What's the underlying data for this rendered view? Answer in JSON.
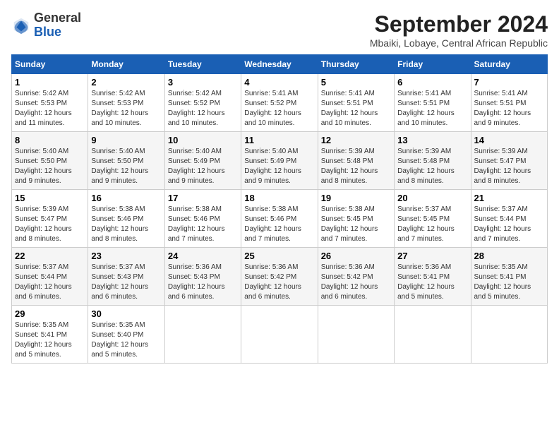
{
  "logo": {
    "general": "General",
    "blue": "Blue"
  },
  "header": {
    "month": "September 2024",
    "location": "Mbaiki, Lobaye, Central African Republic"
  },
  "weekdays": [
    "Sunday",
    "Monday",
    "Tuesday",
    "Wednesday",
    "Thursday",
    "Friday",
    "Saturday"
  ],
  "weeks": [
    [
      {
        "day": "1",
        "sunrise": "Sunrise: 5:42 AM",
        "sunset": "Sunset: 5:53 PM",
        "daylight": "Daylight: 12 hours and 11 minutes."
      },
      {
        "day": "2",
        "sunrise": "Sunrise: 5:42 AM",
        "sunset": "Sunset: 5:53 PM",
        "daylight": "Daylight: 12 hours and 10 minutes."
      },
      {
        "day": "3",
        "sunrise": "Sunrise: 5:42 AM",
        "sunset": "Sunset: 5:52 PM",
        "daylight": "Daylight: 12 hours and 10 minutes."
      },
      {
        "day": "4",
        "sunrise": "Sunrise: 5:41 AM",
        "sunset": "Sunset: 5:52 PM",
        "daylight": "Daylight: 12 hours and 10 minutes."
      },
      {
        "day": "5",
        "sunrise": "Sunrise: 5:41 AM",
        "sunset": "Sunset: 5:51 PM",
        "daylight": "Daylight: 12 hours and 10 minutes."
      },
      {
        "day": "6",
        "sunrise": "Sunrise: 5:41 AM",
        "sunset": "Sunset: 5:51 PM",
        "daylight": "Daylight: 12 hours and 10 minutes."
      },
      {
        "day": "7",
        "sunrise": "Sunrise: 5:41 AM",
        "sunset": "Sunset: 5:51 PM",
        "daylight": "Daylight: 12 hours and 9 minutes."
      }
    ],
    [
      {
        "day": "8",
        "sunrise": "Sunrise: 5:40 AM",
        "sunset": "Sunset: 5:50 PM",
        "daylight": "Daylight: 12 hours and 9 minutes."
      },
      {
        "day": "9",
        "sunrise": "Sunrise: 5:40 AM",
        "sunset": "Sunset: 5:50 PM",
        "daylight": "Daylight: 12 hours and 9 minutes."
      },
      {
        "day": "10",
        "sunrise": "Sunrise: 5:40 AM",
        "sunset": "Sunset: 5:49 PM",
        "daylight": "Daylight: 12 hours and 9 minutes."
      },
      {
        "day": "11",
        "sunrise": "Sunrise: 5:40 AM",
        "sunset": "Sunset: 5:49 PM",
        "daylight": "Daylight: 12 hours and 9 minutes."
      },
      {
        "day": "12",
        "sunrise": "Sunrise: 5:39 AM",
        "sunset": "Sunset: 5:48 PM",
        "daylight": "Daylight: 12 hours and 8 minutes."
      },
      {
        "day": "13",
        "sunrise": "Sunrise: 5:39 AM",
        "sunset": "Sunset: 5:48 PM",
        "daylight": "Daylight: 12 hours and 8 minutes."
      },
      {
        "day": "14",
        "sunrise": "Sunrise: 5:39 AM",
        "sunset": "Sunset: 5:47 PM",
        "daylight": "Daylight: 12 hours and 8 minutes."
      }
    ],
    [
      {
        "day": "15",
        "sunrise": "Sunrise: 5:39 AM",
        "sunset": "Sunset: 5:47 PM",
        "daylight": "Daylight: 12 hours and 8 minutes."
      },
      {
        "day": "16",
        "sunrise": "Sunrise: 5:38 AM",
        "sunset": "Sunset: 5:46 PM",
        "daylight": "Daylight: 12 hours and 8 minutes."
      },
      {
        "day": "17",
        "sunrise": "Sunrise: 5:38 AM",
        "sunset": "Sunset: 5:46 PM",
        "daylight": "Daylight: 12 hours and 7 minutes."
      },
      {
        "day": "18",
        "sunrise": "Sunrise: 5:38 AM",
        "sunset": "Sunset: 5:46 PM",
        "daylight": "Daylight: 12 hours and 7 minutes."
      },
      {
        "day": "19",
        "sunrise": "Sunrise: 5:38 AM",
        "sunset": "Sunset: 5:45 PM",
        "daylight": "Daylight: 12 hours and 7 minutes."
      },
      {
        "day": "20",
        "sunrise": "Sunrise: 5:37 AM",
        "sunset": "Sunset: 5:45 PM",
        "daylight": "Daylight: 12 hours and 7 minutes."
      },
      {
        "day": "21",
        "sunrise": "Sunrise: 5:37 AM",
        "sunset": "Sunset: 5:44 PM",
        "daylight": "Daylight: 12 hours and 7 minutes."
      }
    ],
    [
      {
        "day": "22",
        "sunrise": "Sunrise: 5:37 AM",
        "sunset": "Sunset: 5:44 PM",
        "daylight": "Daylight: 12 hours and 6 minutes."
      },
      {
        "day": "23",
        "sunrise": "Sunrise: 5:37 AM",
        "sunset": "Sunset: 5:43 PM",
        "daylight": "Daylight: 12 hours and 6 minutes."
      },
      {
        "day": "24",
        "sunrise": "Sunrise: 5:36 AM",
        "sunset": "Sunset: 5:43 PM",
        "daylight": "Daylight: 12 hours and 6 minutes."
      },
      {
        "day": "25",
        "sunrise": "Sunrise: 5:36 AM",
        "sunset": "Sunset: 5:42 PM",
        "daylight": "Daylight: 12 hours and 6 minutes."
      },
      {
        "day": "26",
        "sunrise": "Sunrise: 5:36 AM",
        "sunset": "Sunset: 5:42 PM",
        "daylight": "Daylight: 12 hours and 6 minutes."
      },
      {
        "day": "27",
        "sunrise": "Sunrise: 5:36 AM",
        "sunset": "Sunset: 5:41 PM",
        "daylight": "Daylight: 12 hours and 5 minutes."
      },
      {
        "day": "28",
        "sunrise": "Sunrise: 5:35 AM",
        "sunset": "Sunset: 5:41 PM",
        "daylight": "Daylight: 12 hours and 5 minutes."
      }
    ],
    [
      {
        "day": "29",
        "sunrise": "Sunrise: 5:35 AM",
        "sunset": "Sunset: 5:41 PM",
        "daylight": "Daylight: 12 hours and 5 minutes."
      },
      {
        "day": "30",
        "sunrise": "Sunrise: 5:35 AM",
        "sunset": "Sunset: 5:40 PM",
        "daylight": "Daylight: 12 hours and 5 minutes."
      },
      null,
      null,
      null,
      null,
      null
    ]
  ]
}
